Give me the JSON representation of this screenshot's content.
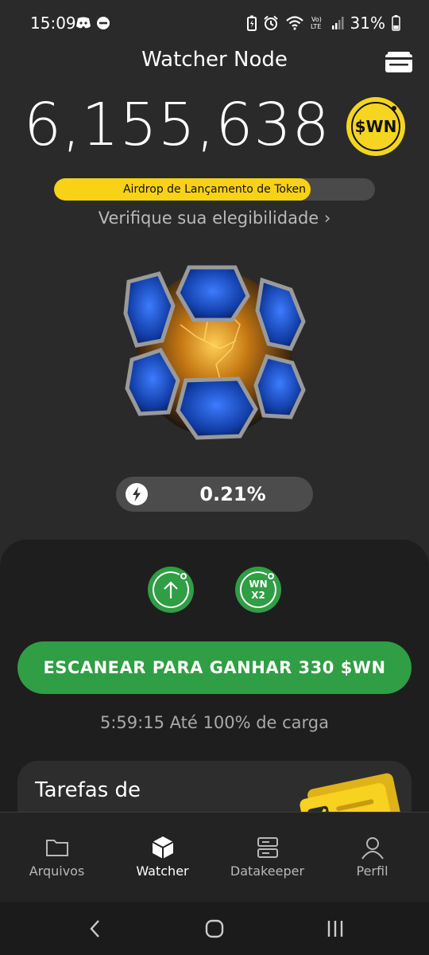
{
  "status_bar": {
    "time": "15:09",
    "battery": "31%",
    "left_icons": [
      "discord-icon",
      "do-not-disturb-icon"
    ],
    "right_icons": [
      "battery-saver-icon",
      "alarm-icon",
      "wifi-icon",
      "volte-icon",
      "signal-icon",
      "battery-icon"
    ],
    "volte_label": "Vo)\nLTE"
  },
  "header": {
    "title": "Watcher Node",
    "wallet_icon": "wallet-icon"
  },
  "balance": {
    "amount": "6,155,638",
    "coin_label": "$WN"
  },
  "airdrop": {
    "label": "Airdrop de Lançamento de Token",
    "progress": 0.8,
    "fill_color": "#f7d216"
  },
  "eligibility": {
    "label": "Verifique sua elegibilidade ›"
  },
  "boost": {
    "icon": "lightning-icon",
    "value": "0.21%"
  },
  "actions": {
    "upgrade_icon": "arrow-up-icon",
    "doubler_label_line1": "WN",
    "doubler_label_line2": "X2",
    "scan_button": "ESCANEAR PARA GANHAR 330 $WN",
    "charge_time": "5:59:15",
    "charge_text": "Até 100% de carga"
  },
  "tasks": {
    "title": "Tarefas de"
  },
  "bottom_nav": [
    {
      "label": "Arquivos",
      "icon": "folder-icon",
      "active": false
    },
    {
      "label": "Watcher",
      "icon": "cube-icon",
      "active": true
    },
    {
      "label": "Datakeeper",
      "icon": "server-icon",
      "active": false
    },
    {
      "label": "Perfil",
      "icon": "person-icon",
      "active": false
    }
  ],
  "colors": {
    "background": "#2a2a2a",
    "accent_green": "#2f9e44",
    "accent_yellow": "#f4d51f",
    "panel": "#1e1e1e"
  }
}
